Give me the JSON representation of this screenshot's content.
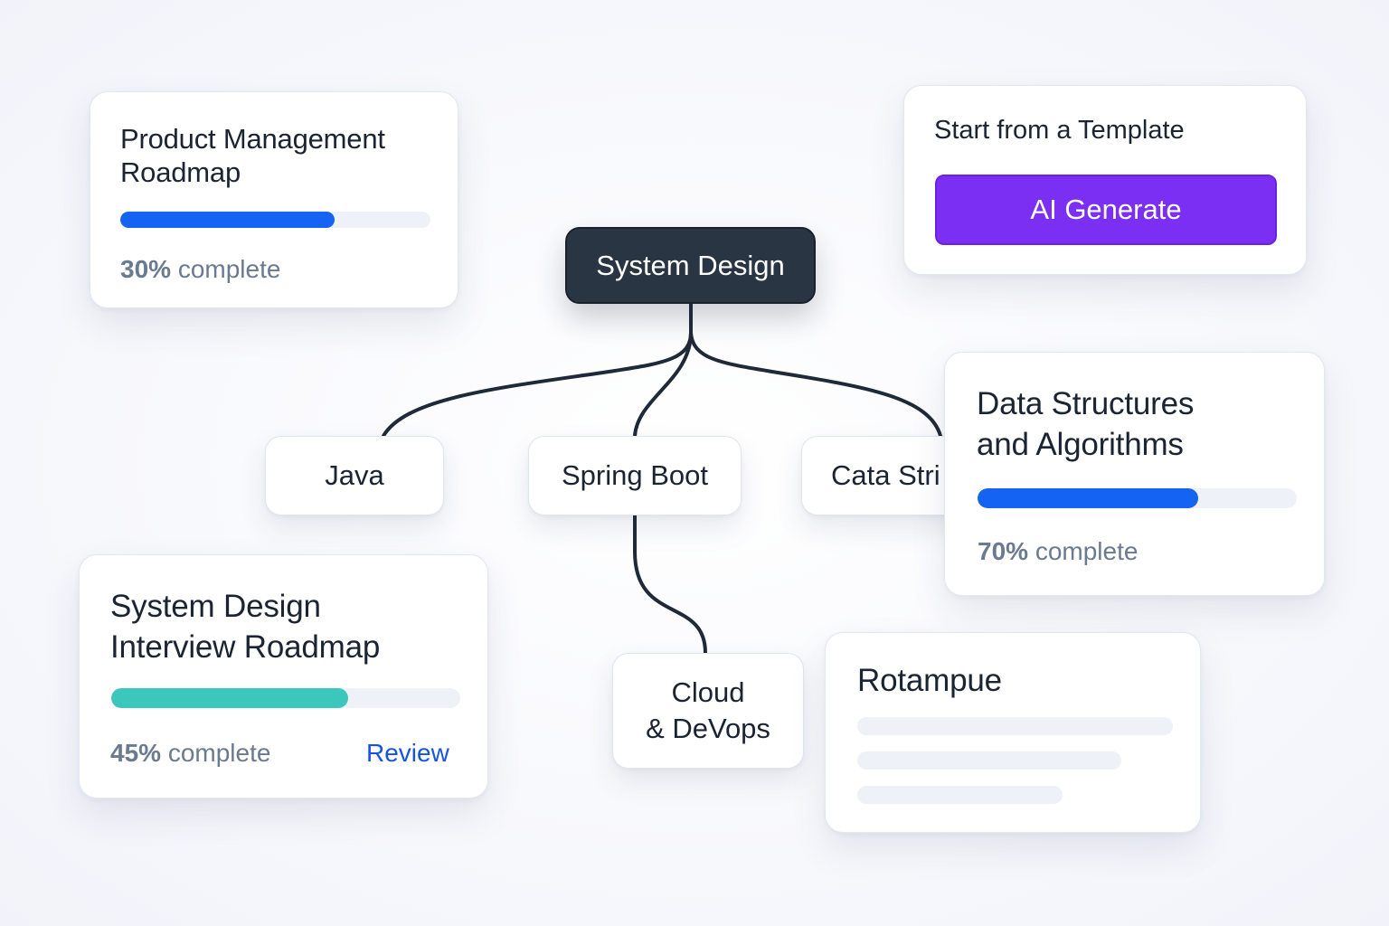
{
  "colors": {
    "progress_blue": "#1463f3",
    "progress_teal": "#3cc7bd",
    "accent_purple": "#7b2ff2",
    "link_blue": "#1554e0",
    "root_node_bg": "#2a3544",
    "connector": "#1f2a38"
  },
  "pm_card": {
    "title_line1": "Product Management",
    "title_line2": "Roadmap",
    "progress_pct": "30%",
    "progress_suffix": " complete",
    "progress_fraction": 0.69
  },
  "template_card": {
    "title": "Start from a Template",
    "button_label": "AI Generate"
  },
  "mindmap": {
    "root": "System Design",
    "nodes": {
      "java": "Java",
      "spring_boot": "Spring Boot",
      "data_structures": "Cata Stri",
      "cloud_line1": "Cloud",
      "cloud_line2": "& DeVops"
    }
  },
  "dsa_card": {
    "title_line1": "Data Structures",
    "title_line2": "and Algorithms",
    "progress_pct": "70%",
    "progress_suffix": " complete",
    "progress_fraction": 0.69
  },
  "sd_card": {
    "title_line1": "System Design",
    "title_line2": "Interview Roadmap",
    "progress_pct": "45%",
    "progress_suffix": " complete",
    "progress_fraction": 0.68,
    "review_label": "Review"
  },
  "placeholder_card": {
    "title": "Rotampue"
  }
}
